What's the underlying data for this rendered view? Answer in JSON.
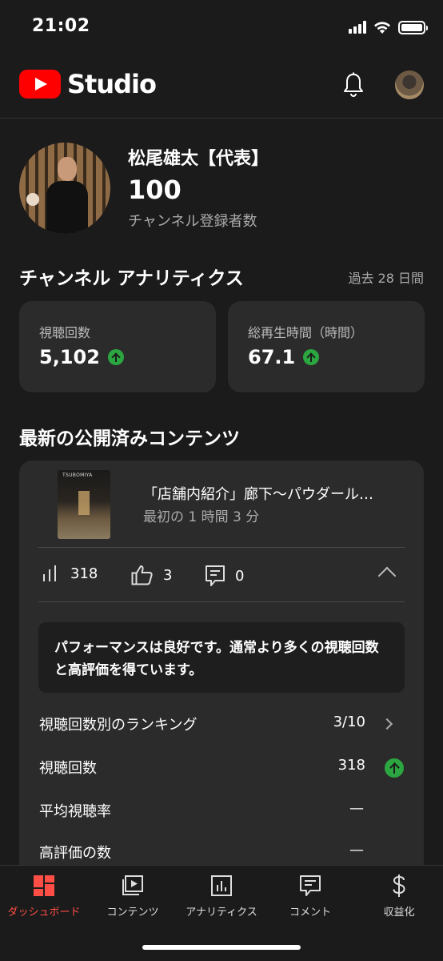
{
  "status_bar": {
    "time": "21:02"
  },
  "header": {
    "logo_text": "Studio"
  },
  "channel": {
    "name": "松尾雄太【代表】",
    "subscribers": "100",
    "subscribers_label": "チャンネル登録者数"
  },
  "analytics": {
    "title": "チャンネル アナリティクス",
    "period": "過去 28 日間",
    "cards": [
      {
        "label": "視聴回数",
        "value": "5,102"
      },
      {
        "label": "総再生時間（時間）",
        "value": "67.1"
      }
    ]
  },
  "latest": {
    "title": "最新の公開済みコンテンツ",
    "thumbnail_text": "TSUBOMIYA",
    "video_title": "「店舗内紹介」廊下〜パウダール…",
    "video_time": "最初の 1 時間 3 分",
    "views": "318",
    "likes": "3",
    "comments": "0",
    "performance": "パフォーマンスは良好です。通常より多くの視聴回数と高評価を得ています。",
    "rows": [
      {
        "label": "視聴回数別のランキング",
        "value": "3/10"
      },
      {
        "label": "視聴回数",
        "value": "318"
      },
      {
        "label": "平均視聴率",
        "value": "—"
      },
      {
        "label": "高評価の数",
        "value": "—"
      }
    ]
  },
  "nav": [
    {
      "label": "ダッシュボード",
      "icon": "dashboard-icon"
    },
    {
      "label": "コンテンツ",
      "icon": "content-icon"
    },
    {
      "label": "アナリティクス",
      "icon": "analytics-icon"
    },
    {
      "label": "コメント",
      "icon": "comment-icon"
    },
    {
      "label": "収益化",
      "icon": "dollar-icon"
    }
  ],
  "colors": {
    "accent": "#ff0000",
    "active_nav": "#ff4e45",
    "up": "#2ba640",
    "card": "#2b2b2b",
    "background": "#1b1b1b"
  }
}
